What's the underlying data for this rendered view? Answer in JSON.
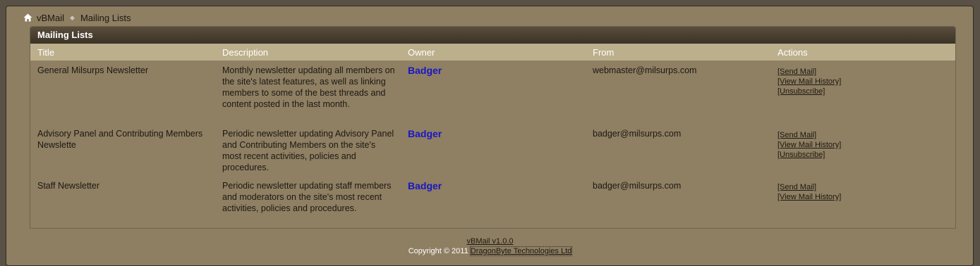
{
  "breadcrumb": {
    "home_icon": "home-icon",
    "items": [
      "vBMail",
      "Mailing Lists"
    ]
  },
  "panel": {
    "title": "Mailing Lists",
    "columns": [
      "Title",
      "Description",
      "Owner",
      "From",
      "Actions"
    ],
    "rows": [
      {
        "title": "General Milsurps Newsletter",
        "description": "Monthly newsletter updating all members on the site's latest features, as well as linking members to some of the best threads and content posted in the last month.",
        "owner": "Badger",
        "from": "webmaster@milsurps.com",
        "actions": [
          "[Send Mail]",
          "[View Mail History]",
          "[Unsubscribe]"
        ]
      },
      {
        "title": "Advisory Panel and Contributing Members Newslette",
        "description": "Periodic newsletter updating Advisory Panel and Contributing Members on the site's most recent activities, policies and procedures.",
        "owner": "Badger",
        "from": "badger@milsurps.com",
        "actions": [
          "[Send Mail]",
          "[View Mail History]",
          "[Unsubscribe]"
        ]
      },
      {
        "title": "Staff Newsletter",
        "description": "Periodic newsletter updating staff members and moderators on the site's most recent activities, policies and procedures.",
        "owner": "Badger",
        "from": "badger@milsurps.com",
        "actions": [
          "[Send Mail]",
          "[View Mail History]"
        ]
      }
    ]
  },
  "footer": {
    "version": "vBMail v1.0.0",
    "copyright": "Copyright © 2011",
    "company": "DragonByte Technologies Ltd"
  }
}
